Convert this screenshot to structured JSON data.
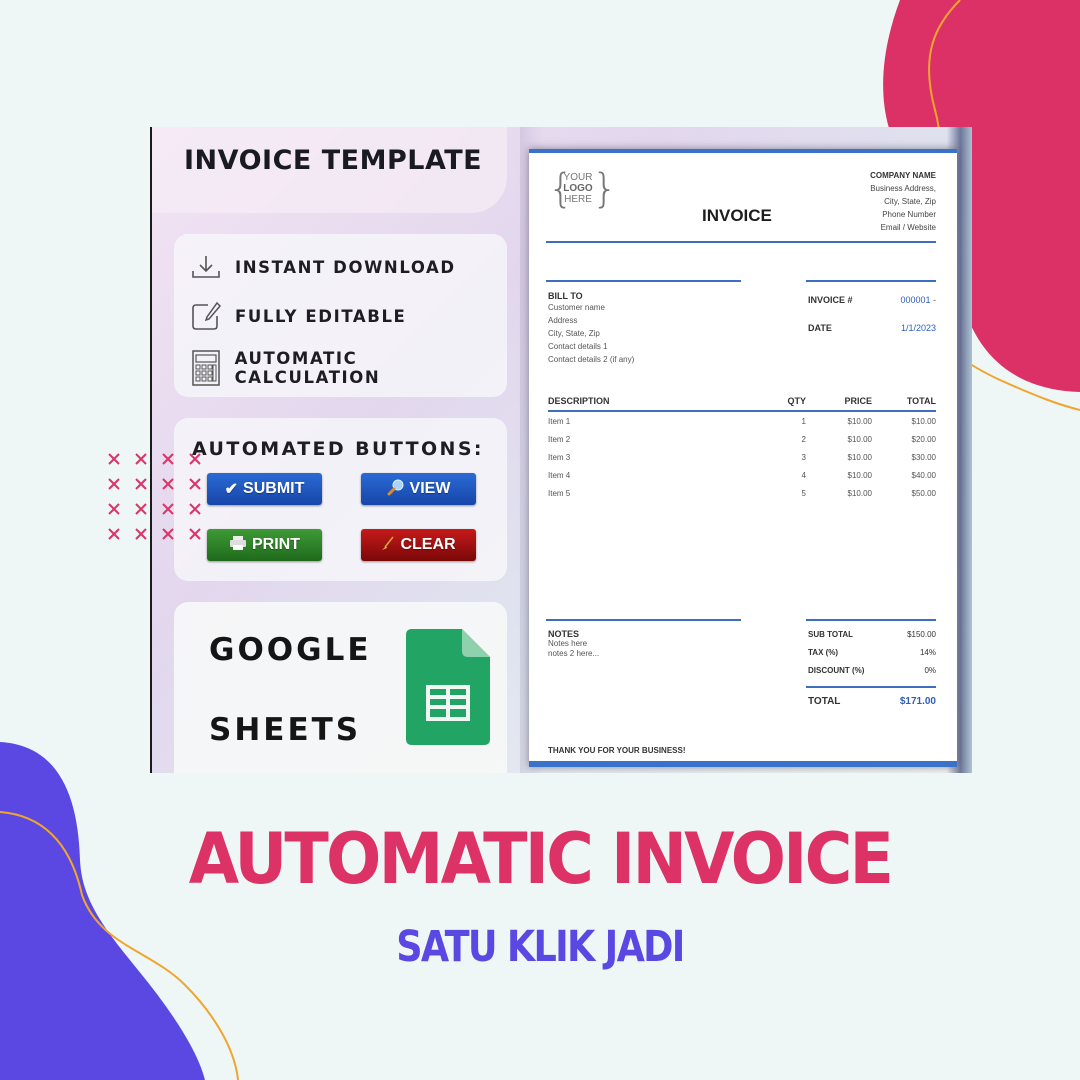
{
  "colors": {
    "background": "#eef7f6",
    "pink_accent": "#dd3266",
    "purple_accent": "#5b48e3",
    "orange_line": "#f0a52e",
    "invoice_blue": "#3d6fbe",
    "sheets_green": "#21a464"
  },
  "promo": {
    "panel_title": "INVOICE TEMPLATE",
    "features": [
      {
        "icon": "download-icon",
        "label": "INSTANT DOWNLOAD"
      },
      {
        "icon": "edit-icon",
        "label": "FULLY EDITABLE"
      },
      {
        "icon": "calculator-icon",
        "label": "AUTOMATIC CALCULATION"
      }
    ],
    "buttons_heading": "AUTOMATED BUTTONS:",
    "buttons": [
      {
        "icon": "check-icon",
        "glyph": "✔",
        "label": "SUBMIT"
      },
      {
        "icon": "magnifier-icon",
        "glyph": "",
        "label": "VIEW"
      },
      {
        "icon": "printer-icon",
        "glyph": "",
        "label": "PRINT"
      },
      {
        "icon": "broom-icon",
        "glyph": "",
        "label": "CLEAR"
      }
    ],
    "platform_line1": "GOOGLE",
    "platform_line2": "SHEETS"
  },
  "invoice": {
    "logo_lines": [
      "YOUR",
      "LOGO",
      "HERE"
    ],
    "title": "INVOICE",
    "company": {
      "name": "COMPANY NAME",
      "lines": [
        "Business Address,",
        "City, State, Zip",
        "Phone Number",
        "Email / Website"
      ]
    },
    "bill_to": {
      "label": "BILL TO",
      "lines": [
        "Customer name",
        "Address",
        "City, State, Zip",
        "Contact details 1",
        "Contact details 2 (if any)"
      ]
    },
    "invoice_no_label": "INVOICE #",
    "invoice_no": "000001",
    "invoice_no_suffix": "-",
    "date_label": "DATE",
    "date": "1/1/2023",
    "columns": [
      "DESCRIPTION",
      "QTY",
      "PRICE",
      "TOTAL"
    ],
    "items": [
      {
        "desc": "Item 1",
        "qty": "1",
        "price": "$10.00",
        "total": "$10.00"
      },
      {
        "desc": "Item 2",
        "qty": "2",
        "price": "$10.00",
        "total": "$20.00"
      },
      {
        "desc": "Item 3",
        "qty": "3",
        "price": "$10.00",
        "total": "$30.00"
      },
      {
        "desc": "Item 4",
        "qty": "4",
        "price": "$10.00",
        "total": "$40.00"
      },
      {
        "desc": "Item 5",
        "qty": "5",
        "price": "$10.00",
        "total": "$50.00"
      }
    ],
    "notes": {
      "label": "NOTES",
      "lines": [
        "Notes here",
        "notes 2 here..."
      ]
    },
    "subtotal_label": "SUB TOTAL",
    "subtotal": "$150.00",
    "tax_label": "TAX (%)",
    "tax": "14%",
    "discount_label": "DISCOUNT (%)",
    "discount": "0%",
    "total_label": "TOTAL",
    "total": "$171.00",
    "thanks": "THANK YOU FOR YOUR BUSINESS!"
  },
  "headline": "AUTOMATIC INVOICE",
  "subheadline": "SATU KLIK JADI"
}
